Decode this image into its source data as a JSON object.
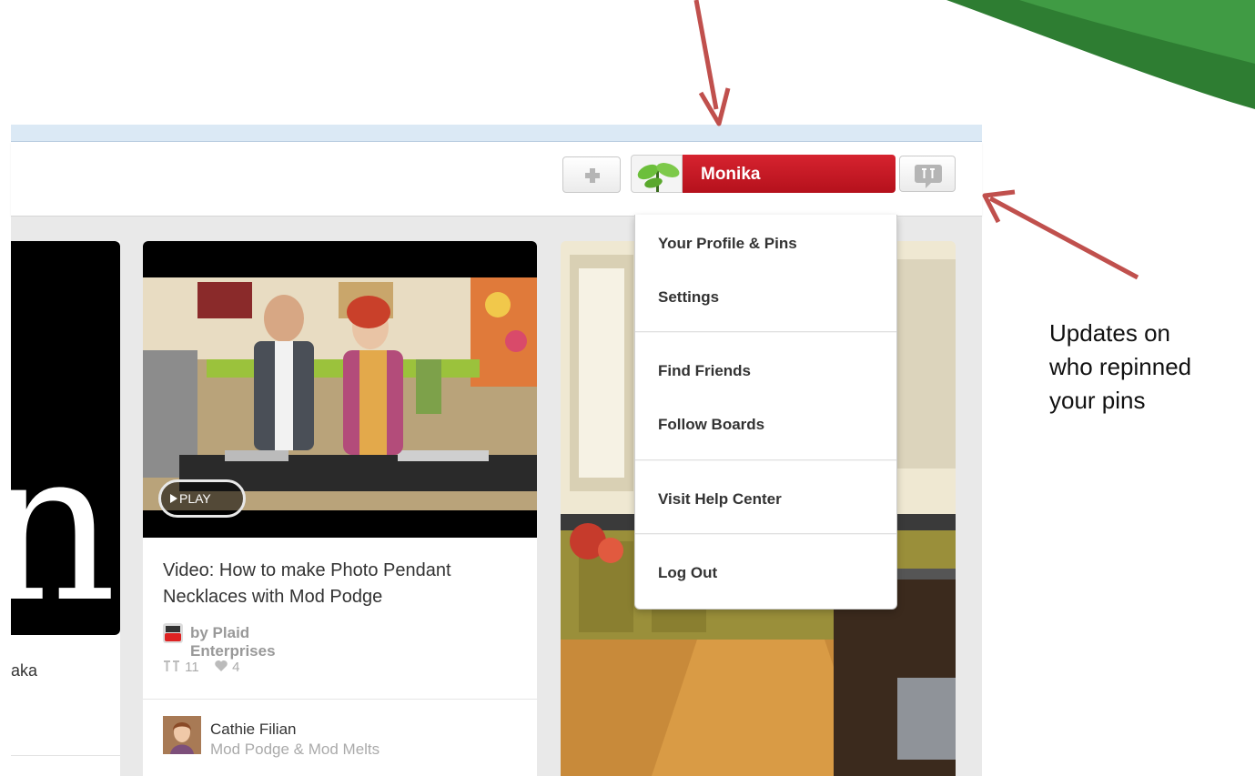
{
  "header": {
    "user_name": "Monika"
  },
  "dropdown": {
    "items": [
      "Your Profile & Pins",
      "Settings",
      "Find Friends",
      "Follow Boards",
      "Visit Help Center",
      "Log Out"
    ]
  },
  "pins": {
    "left": {
      "caption": "aka"
    },
    "video": {
      "play_label": "PLAY",
      "title": "Video: How to make Photo Pendant Necklaces with Mod Podge",
      "source": "by Plaid Enterprises",
      "repins": "11",
      "likes": "4",
      "pinner_name": "Cathie Filian",
      "pinner_board": "Mod Podge & Mod Melts"
    }
  },
  "annotation": {
    "line1": "Updates on",
    "line2": "who repinned",
    "line3": "your pins"
  },
  "colors": {
    "user_red": "#c61a26",
    "arrow_red": "#c0504d",
    "swoosh_green": "#2e7d32",
    "feed_gray": "#e9e9e9"
  },
  "icons": [
    "plus-icon",
    "avatar-plant-icon",
    "notification-pin-icon",
    "youtube-icon",
    "repin-icon",
    "heart-icon",
    "play-icon"
  ]
}
